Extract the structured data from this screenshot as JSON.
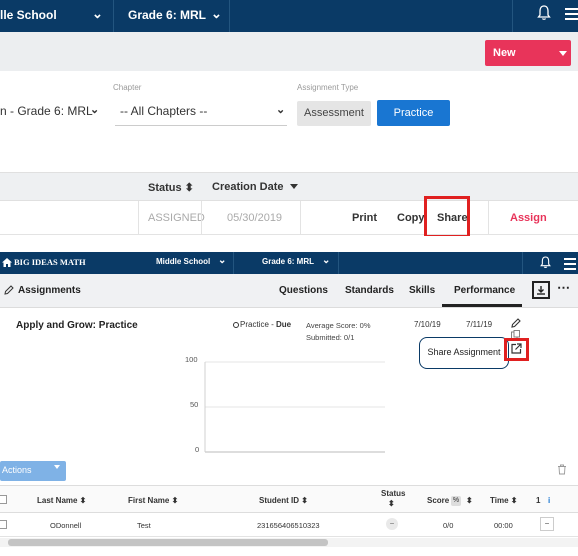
{
  "top": {
    "school": "lle School",
    "grade": "Grade 6: MRL",
    "new_label": "New",
    "chapter_label": "Chapter",
    "assignment_type_label": "Assignment Type",
    "course_value": "n - Grade 6: MRL",
    "chapter_value": "-- All Chapters --",
    "assessment_label": "Assessment",
    "practice_label": "Practice",
    "headers": {
      "status": "Status ⬍",
      "creation_date": "Creation Date"
    },
    "row": {
      "status": "ASSIGNED",
      "date": "05/30/2019",
      "print": "Print",
      "copy": "Copy",
      "share": "Share",
      "assign": "Assign"
    }
  },
  "bottom": {
    "brand": "BIG IDEAS MATH",
    "school": "Middle School",
    "grade": "Grade 6: MRL",
    "assignments_label": "Assignments",
    "tabs": [
      "Questions",
      "Standards",
      "Skills",
      "Performance"
    ],
    "assignment_title": "Apply and Grow: Practice",
    "practice_prefix": "Practice - ",
    "due_label": "Due",
    "average_score": "Average Score: 0%",
    "submitted": "Submitted: 0/1",
    "date_start": "7/10/19",
    "date_end": "7/11/19",
    "share_assignment": "Share Assignment",
    "chart_ticks": [
      "100",
      "50",
      "0"
    ],
    "actions_label": "Actions",
    "columns": {
      "last_name": "Last Name ⬍",
      "first_name": "First Name ⬍",
      "student_id": "Student ID ⬍",
      "status": "Status",
      "score": "Score",
      "percent": "%",
      "time": "Time ⬍",
      "one": "1",
      "info": "i"
    },
    "row": {
      "last_name": "ODonnell",
      "first_name": "Test",
      "student_id": "231656406510323",
      "status": "−",
      "score": "0/0",
      "time": "00:00",
      "q1": "−"
    }
  },
  "colors": {
    "nav": "#0a3a66",
    "new_button": "#e8345a",
    "practice_button": "#1976d2",
    "assign_text": "#e8345a",
    "highlight": "#e02020"
  },
  "chart_data": {
    "type": "line",
    "title": "",
    "xlabel": "",
    "ylabel": "",
    "ylim": [
      0,
      100
    ],
    "yticks": [
      100,
      50,
      0
    ],
    "series": []
  }
}
